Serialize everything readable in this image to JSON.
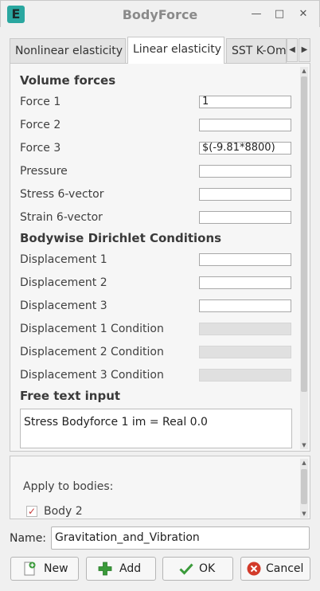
{
  "window": {
    "app_icon": "E",
    "title": "BodyForce",
    "minimize_glyph": "—",
    "maximize_glyph": "□",
    "close_glyph": "✕"
  },
  "tabs": [
    {
      "label": "Nonlinear elasticity",
      "active": false
    },
    {
      "label": "Linear elasticity",
      "active": true
    },
    {
      "label": "SST K-Omega",
      "active": false
    }
  ],
  "tab_scroll": {
    "left_glyph": "◀",
    "right_glyph": "▶"
  },
  "volume_forces": {
    "heading": "Volume forces",
    "fields": [
      {
        "label": "Force 1",
        "value": "1"
      },
      {
        "label": "Force 2",
        "value": ""
      },
      {
        "label": "Force 3",
        "value": "$(-9.81*8800)"
      },
      {
        "label": "Pressure",
        "value": ""
      },
      {
        "label": "Stress 6-vector",
        "value": ""
      },
      {
        "label": "Strain 6-vector",
        "value": ""
      }
    ]
  },
  "dirichlet": {
    "heading": "Bodywise Dirichlet Conditions",
    "fields": [
      {
        "label": "Displacement 1",
        "value": ""
      },
      {
        "label": "Displacement 2",
        "value": ""
      },
      {
        "label": "Displacement 3",
        "value": ""
      },
      {
        "label": "Displacement 1 Condition",
        "value": ""
      },
      {
        "label": "Displacement 2 Condition",
        "value": ""
      },
      {
        "label": "Displacement 3 Condition",
        "value": ""
      }
    ]
  },
  "free_text": {
    "heading": "Free text input",
    "value": "Stress Bodyforce 1 im = Real 0.0"
  },
  "bodies": {
    "heading": "Apply to bodies:",
    "items": [
      {
        "label": "Body 2",
        "checked": true,
        "check_glyph": "✓"
      }
    ]
  },
  "name": {
    "label": "Name:",
    "value": "Gravitation_and_Vibration"
  },
  "buttons": {
    "new": "New",
    "add": "Add",
    "ok": "OK",
    "cancel": "Cancel"
  },
  "colors": {
    "add_green": "#3a9a3a",
    "cancel_red": "#d23a2a",
    "app_teal": "#2aa7a0"
  }
}
